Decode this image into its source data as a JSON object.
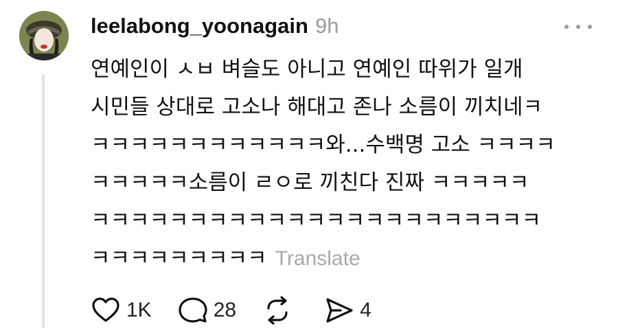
{
  "post": {
    "username": "leelabong_yoonagain",
    "timestamp": "9h",
    "body_lines": [
      "연예인이 ㅅㅂ 벼슬도 아니고 연예인 따위가 일개",
      "시민들 상대로 고소나 해대고 존나 소름이 끼치네ㅋ",
      "ㅋㅋㅋㅋㅋㅋㅋㅋㅋㅋㅋㅋ와...수백명 고소 ㅋㅋㅋㅋ",
      "ㅋㅋㅋㅋㅋ소름이 ㄹㅇ로 끼친다 진짜 ㅋㅋㅋㅋㅋ",
      "ㅋㅋㅋㅋㅋㅋㅋㅋㅋㅋㅋㅋㅋㅋㅋㅋㅋㅋㅋㅋㅋㅋㅋ",
      "ㅋㅋㅋㅋㅋㅋㅋㅋㅋ"
    ],
    "translate_label": "Translate"
  },
  "actions": {
    "like": {
      "icon": "heart-icon",
      "count": "1K"
    },
    "reply": {
      "icon": "comment-icon",
      "count": "28"
    },
    "repost": {
      "icon": "repost-icon",
      "count": ""
    },
    "share": {
      "icon": "send-icon",
      "count": "4"
    }
  },
  "colors": {
    "text": "#111111",
    "muted": "#9b9b9b",
    "thread_line": "#e3e3e3",
    "background": "#ffffff"
  }
}
